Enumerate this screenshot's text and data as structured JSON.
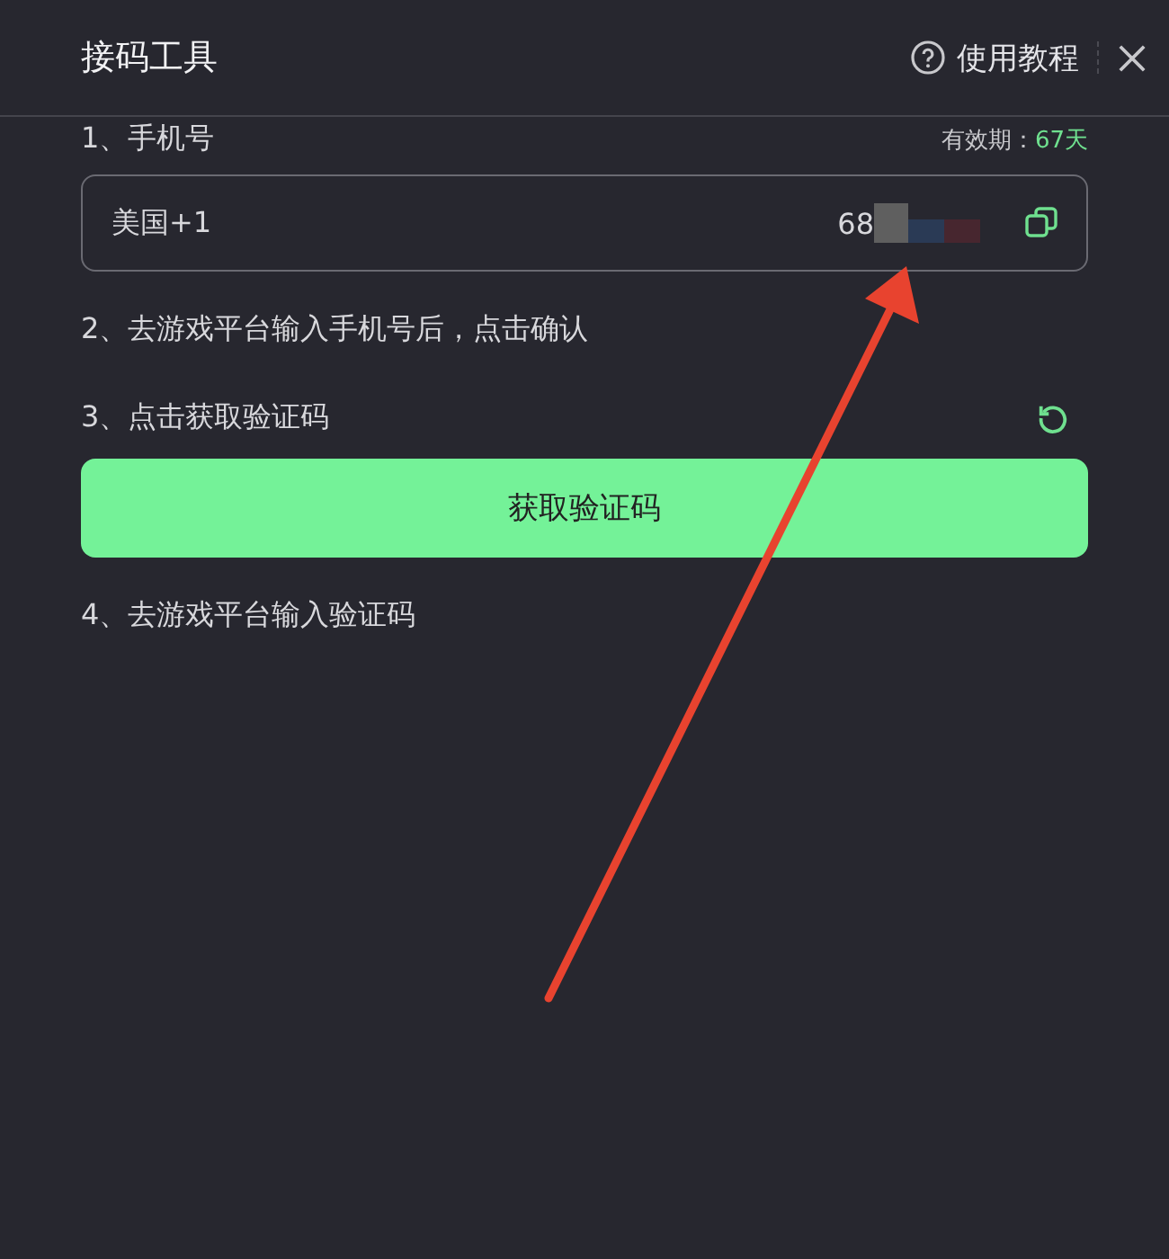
{
  "window": {
    "title": "接码工具",
    "help_link": "使用教程"
  },
  "steps": [
    {
      "kind": "phone",
      "label": "1、手机号",
      "validity_label": "有效期：",
      "validity_value": "67天",
      "country": "美国+1",
      "number": "68"
    },
    {
      "kind": "text",
      "label": "2、去游戏平台输入手机号后，点击确认"
    },
    {
      "kind": "action",
      "label": "3、点击获取验证码",
      "button": "获取验证码"
    },
    {
      "kind": "text",
      "label": "4、去游戏平台输入验证码"
    }
  ]
}
